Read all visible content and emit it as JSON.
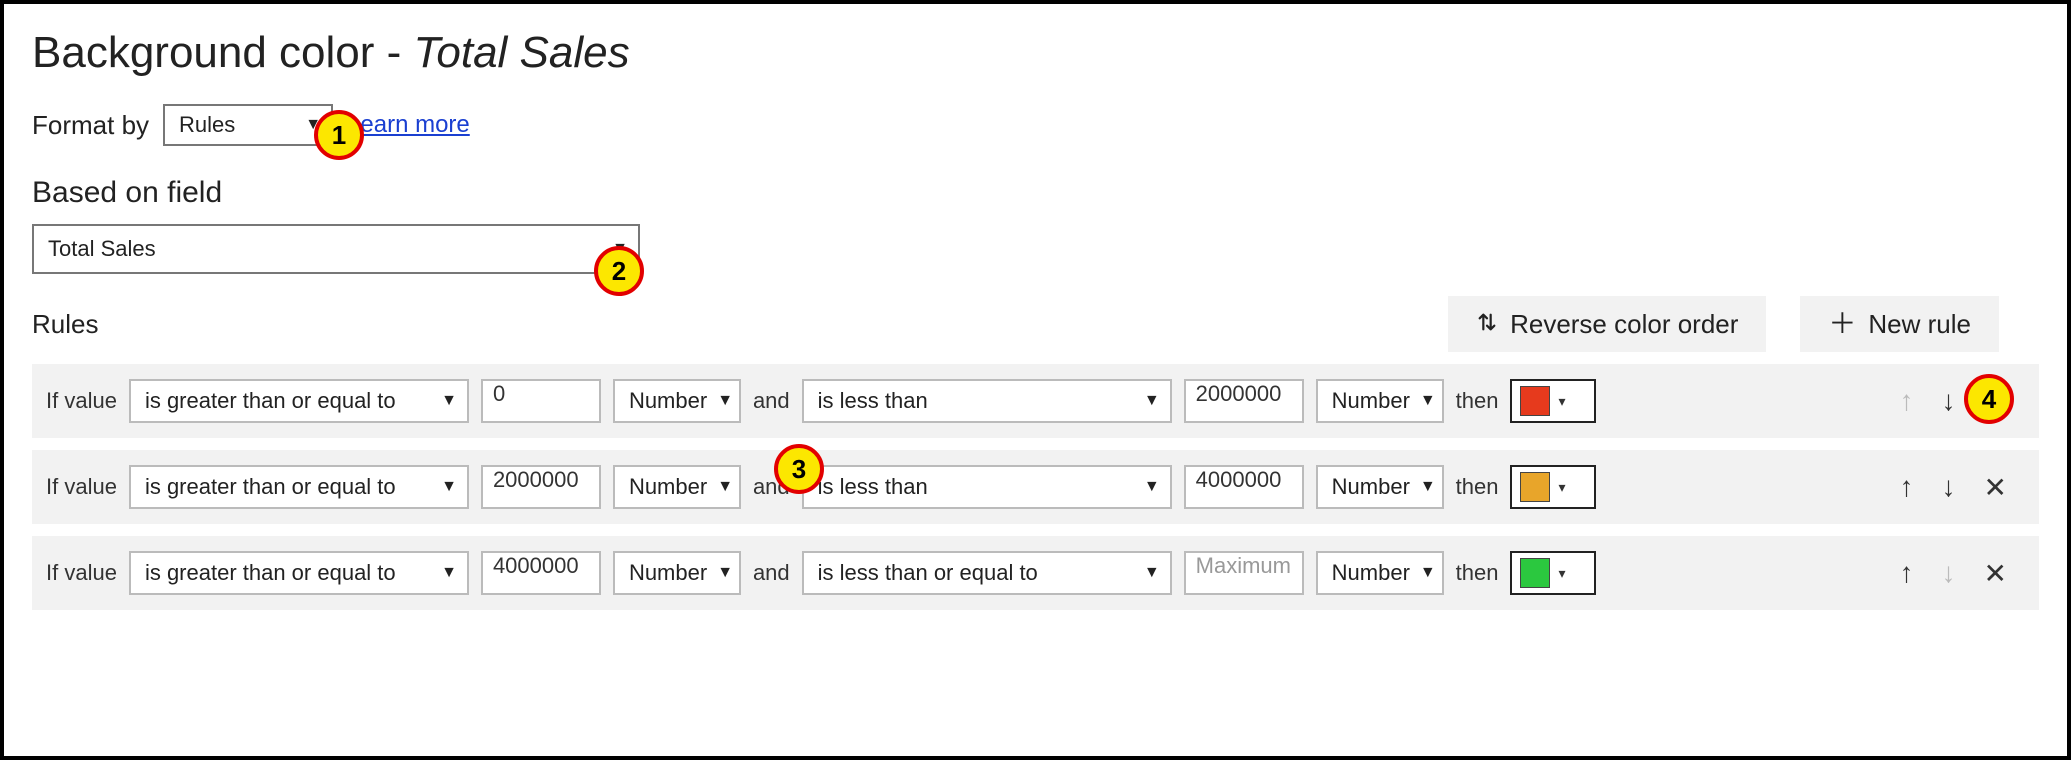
{
  "title": {
    "prefix": "Background color",
    "dash": " - ",
    "field": "Total Sales"
  },
  "formatBy": {
    "label": "Format by",
    "value": "Rules",
    "learnMore": "Learn more"
  },
  "basedOn": {
    "heading": "Based on field",
    "value": "Total Sales"
  },
  "rulesLabel": "Rules",
  "buttons": {
    "reverse": "Reverse color order",
    "newRule": "New rule"
  },
  "ruleText": {
    "ifValue": "If value",
    "and": "and",
    "then": "then"
  },
  "typeLabel": "Number",
  "rules": [
    {
      "op1": "is greater than or equal to",
      "v1": "0",
      "v1ph": false,
      "op2": "is less than",
      "v2": "2000000",
      "v2ph": false,
      "color": "#e63a1d",
      "up": false,
      "down": true,
      "close": true
    },
    {
      "op1": "is greater than or equal to",
      "v1": "2000000",
      "v1ph": false,
      "op2": "is less than",
      "v2": "4000000",
      "v2ph": false,
      "color": "#e8a52a",
      "up": true,
      "down": true,
      "close": true
    },
    {
      "op1": "is greater than or equal to",
      "v1": "4000000",
      "v1ph": false,
      "op2": "is less than or equal to",
      "v2": "Maximum",
      "v2ph": true,
      "color": "#2bc83f",
      "up": true,
      "down": false,
      "close": true
    }
  ],
  "callouts": {
    "1": "1",
    "2": "2",
    "3": "3",
    "4": "4"
  }
}
